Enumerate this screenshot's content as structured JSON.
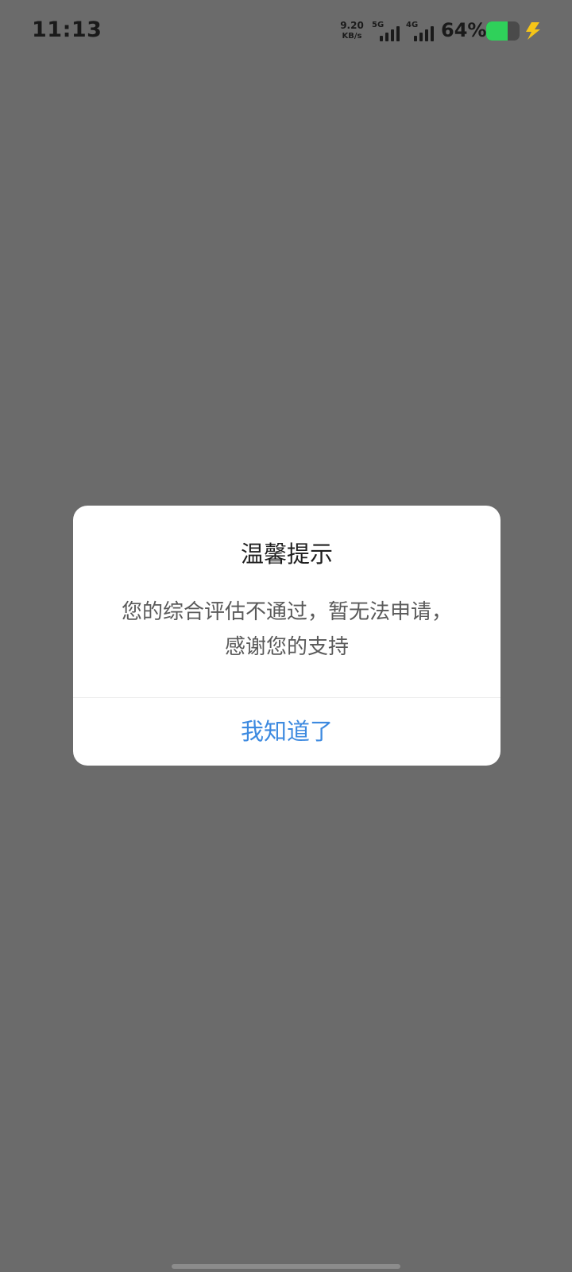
{
  "status_bar": {
    "time": "11:13",
    "net_speed_value": "9.20",
    "net_speed_unit": "KB/s",
    "sim1_type": "5G",
    "sim2_type": "4G",
    "battery_percent_text": "64%",
    "battery_level": 0.64,
    "battery_color": "#2fd15a",
    "charging_icon": "lightning-bolt-icon",
    "charging_color": "#f5c518"
  },
  "dialog": {
    "title": "温馨提示",
    "message": "您的综合评估不通过，暂无法申请，感谢您的支持",
    "button_label": "我知道了",
    "button_color": "#3d8ae0"
  }
}
